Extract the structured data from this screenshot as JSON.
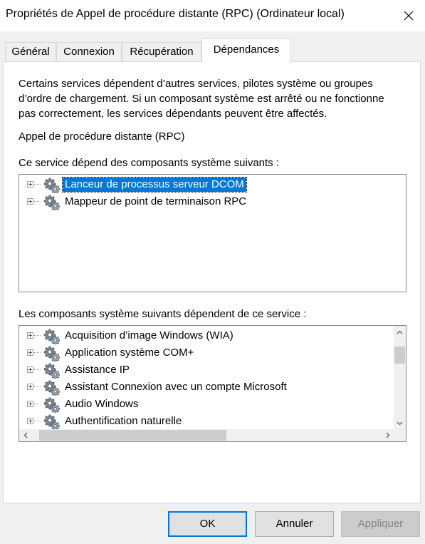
{
  "window": {
    "title": "Propriétés de Appel de procédure distante (RPC) (Ordinateur local)"
  },
  "tabs": [
    {
      "label": "Général"
    },
    {
      "label": "Connexion"
    },
    {
      "label": "Récupération"
    },
    {
      "label": "Dépendances",
      "active": true
    }
  ],
  "panel": {
    "description_lines": [
      "Certains services dépendent d’autres services, pilotes système ou groupes",
      "d’ordre de chargement. Si un composant système est arrêté ou ne fonctionne",
      "pas correctement, les services dépendants peuvent être affectés."
    ],
    "service_name": "Appel de procédure distante (RPC)",
    "depends_on_label": "Ce service dépend des composants système suivants :",
    "depends_on_items": [
      {
        "label": "Lanceur de processus serveur DCOM",
        "selected": true
      },
      {
        "label": "Mappeur de point de terminaison RPC"
      }
    ],
    "dependents_label": "Les composants système suivants dépendent de ce service :",
    "dependents_items": [
      {
        "label": "Acquisition d’image Windows (WIA)"
      },
      {
        "label": "Application système COM+"
      },
      {
        "label": "Assistance IP"
      },
      {
        "label": "Assistant Connexion avec un compte Microsoft"
      },
      {
        "label": "Audio Windows"
      },
      {
        "label": "Authentification naturelle"
      }
    ]
  },
  "icons": {
    "close": "close-icon",
    "service": "gear-icon",
    "expand": "plus-expander-icon",
    "scroll_up": "chevron-up-icon",
    "scroll_down": "chevron-down-icon",
    "scroll_left": "chevron-left-icon",
    "scroll_right": "chevron-right-icon"
  },
  "buttons": {
    "ok": "OK",
    "cancel": "Annuler",
    "apply": "Appliquer"
  },
  "colors": {
    "selection": "#0078d7",
    "default_button_border": "#0078d7"
  }
}
